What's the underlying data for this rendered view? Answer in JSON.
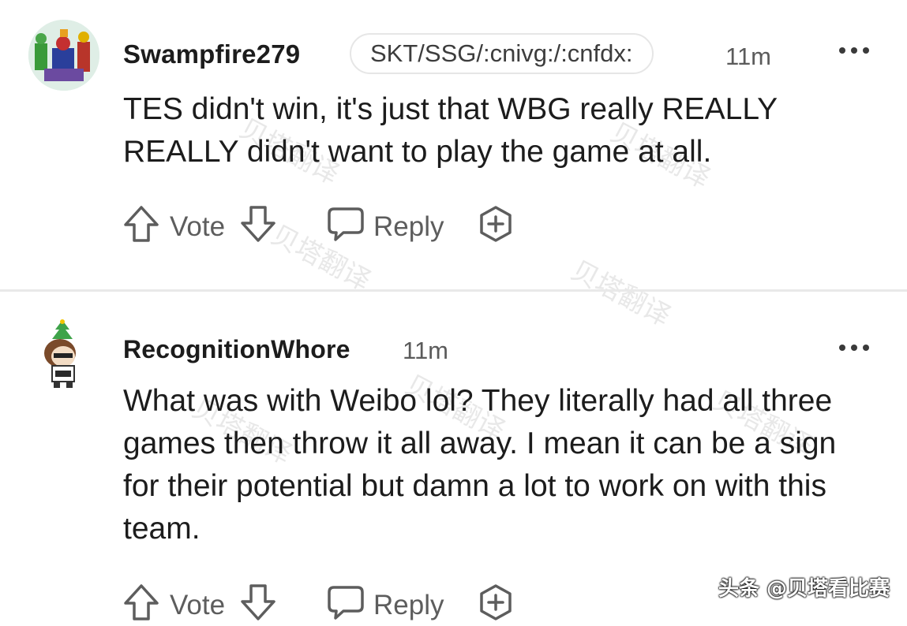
{
  "comments": [
    {
      "username": "Swampfire279",
      "flair": "SKT/SSG/:cnivg:/:cnfdx:",
      "time": "11m",
      "body": "TES didn't win, it's just that WBG really REALLY REALLY didn't want to play the game at all.",
      "vote_label": "Vote",
      "reply_label": "Reply"
    },
    {
      "username": "RecognitionWhore",
      "time": "11m",
      "body": "What was with Weibo lol? They literally had all three games then throw it all away. I mean it can be a sign for their potential but damn a lot to work on with this team.",
      "vote_label": "Vote",
      "reply_label": "Reply"
    }
  ],
  "icons": {
    "upvote": "arrow-up-icon",
    "downvote": "arrow-down-icon",
    "reply": "speech-bubble-icon",
    "award": "plus-circle-icon",
    "more": "more-dots-icon"
  },
  "colors": {
    "icon_gray": "#5d5d5d",
    "divider": "#e9e9e9"
  },
  "watermark_text": "贝塔翻译",
  "credit": "头条 @贝塔看比赛"
}
